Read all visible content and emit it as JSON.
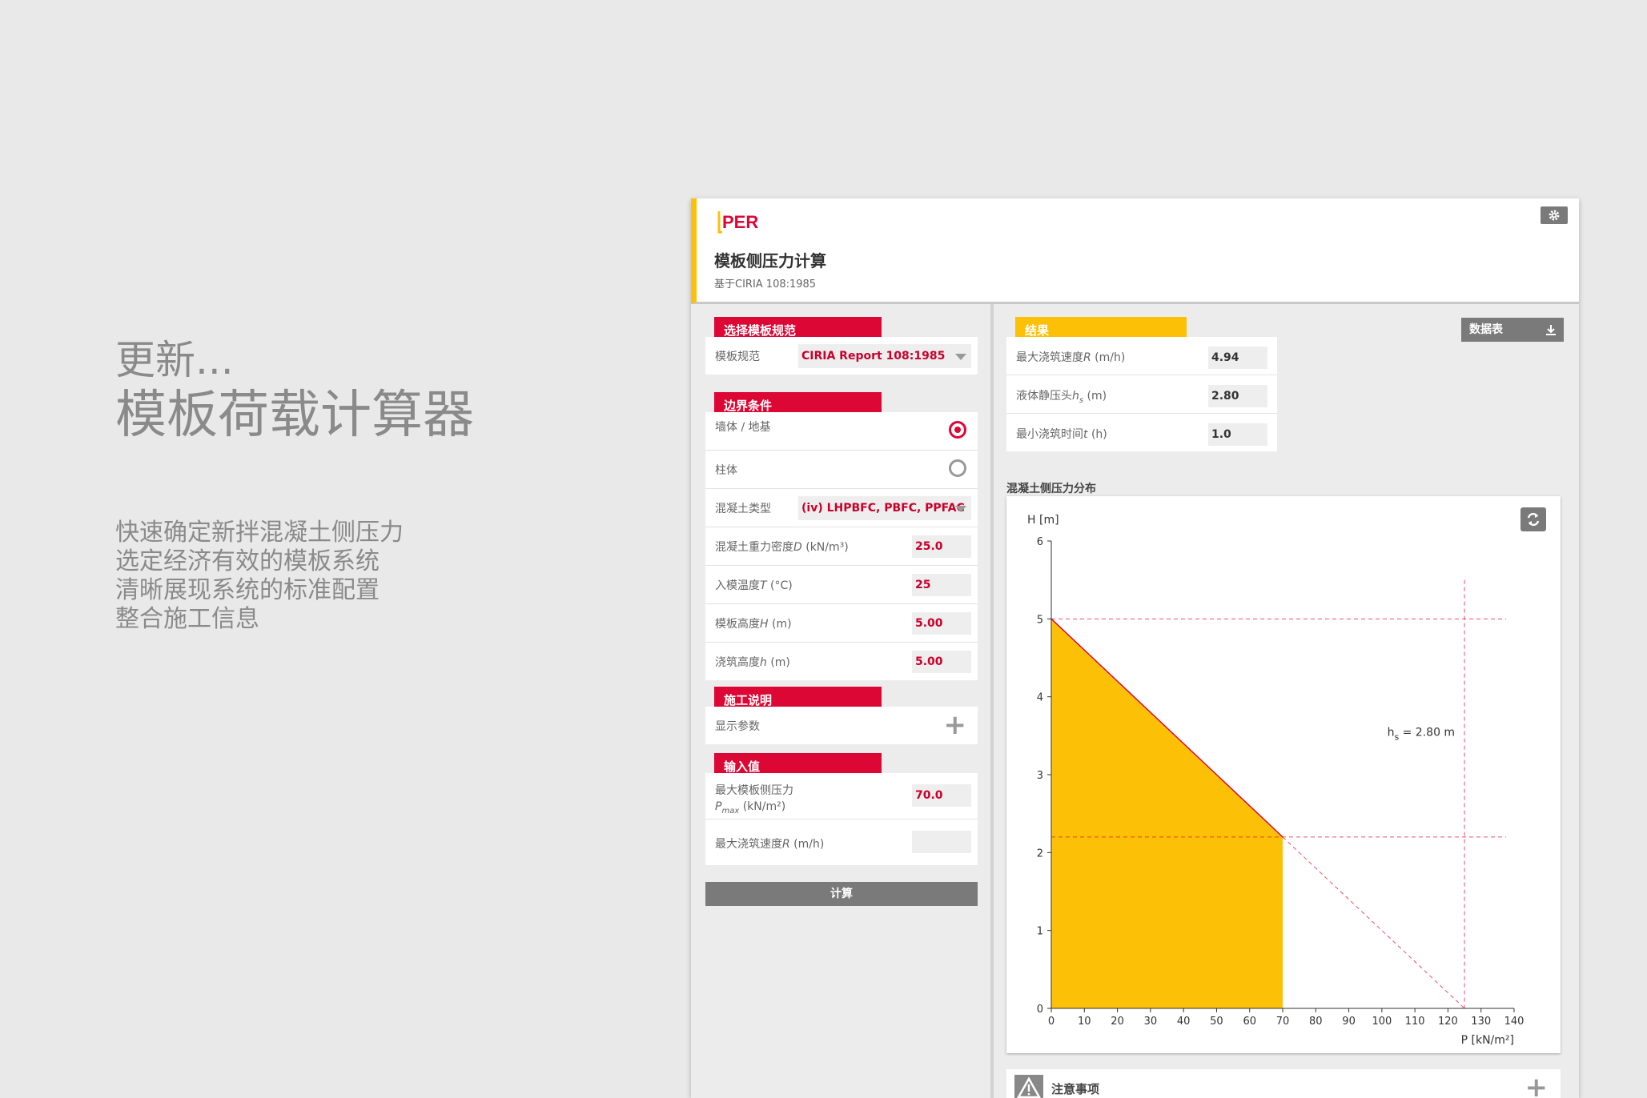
{
  "promo": {
    "line1": "更新...",
    "line2": "模板荷载计算器",
    "bullets": [
      "快速确定新拌混凝土侧压力",
      "选定经济有效的模板系统",
      "清晰展现系统的标准配置",
      "整合施工信息"
    ]
  },
  "app": {
    "logo": "PERI",
    "title": "模板侧压力计算",
    "subtitle": "基于CIRIA 108:1985"
  },
  "spec": {
    "section": "选择模板规范",
    "label": "模板规范",
    "value": "CIRIA Report 108:1985"
  },
  "boundary": {
    "section": "边界条件",
    "wall_label": "墙体 / 地基",
    "column_label": "柱体",
    "concrete_type_label": "混凝土类型",
    "concrete_type_value": "(iv) LHPBFC, PBFC, PPFAC",
    "density_label_pre": "混凝土重力密度",
    "density_sym": "D",
    "density_unit": " (kN/m³)",
    "density_value": "25.0",
    "temp_label_pre": "入模温度",
    "temp_sym": "T",
    "temp_unit": " (°C)",
    "temp_value": "25",
    "form_h_label_pre": "模板高度",
    "form_h_sym": "H",
    "form_h_unit": " (m)",
    "form_h_value": "5.00",
    "pour_h_label_pre": "浇筑高度",
    "pour_h_sym": "h",
    "pour_h_unit": " (m)",
    "pour_h_value": "5.00"
  },
  "construction": {
    "section": "施工说明",
    "show_params": "显示参数"
  },
  "input": {
    "section": "输入值",
    "pmax_label": "最大模板侧压力",
    "pmax_sym": "P",
    "pmax_sub": "max",
    "pmax_unit": " (kN/m²)",
    "pmax_value": "70.0",
    "rate_label_pre": "最大浇筑速度",
    "rate_sym": "R",
    "rate_unit": " (m/h)",
    "rate_value": ""
  },
  "calc_button": "计算",
  "results": {
    "section": "结果",
    "datasheet_button": "数据表",
    "rate_label_pre": "最大浇筑速度",
    "rate_sym": "R",
    "rate_unit": " (m/h)",
    "rate_value": "4.94",
    "hs_label_pre": "液体静压头",
    "hs_sym": "h",
    "hs_sub": "s",
    "hs_unit": " (m)",
    "hs_value": "2.80",
    "time_label_pre": "最小浇筑时间",
    "time_sym": "t",
    "time_unit": " (h)",
    "time_value": "1.0"
  },
  "chart_section": "混凝土侧压力分布",
  "notes": "注意事项",
  "colors": {
    "red": "#dd0735",
    "yellow": "#fcc107",
    "gray": "#7a7a7a"
  },
  "chart_data": {
    "type": "area",
    "ylabel": "H [m]",
    "xlabel": "P [kN/m²]",
    "xlim": [
      0,
      140
    ],
    "ylim": [
      0,
      6
    ],
    "xticks": [
      0,
      10,
      20,
      30,
      40,
      50,
      60,
      70,
      80,
      90,
      100,
      110,
      120,
      130,
      140
    ],
    "yticks": [
      0,
      1,
      2,
      3,
      4,
      5,
      6
    ],
    "pressure_profile": [
      {
        "p": 0,
        "h": 5.0
      },
      {
        "p": 70,
        "h": 2.2
      },
      {
        "p": 70,
        "h": 0
      }
    ],
    "hydrostatic_line": [
      {
        "p": 70,
        "h": 2.2
      },
      {
        "p": 125,
        "h": 0
      }
    ],
    "ref_h_lines": [
      5.0,
      2.2
    ],
    "ref_p_line": 125,
    "annotation": "h_s = 2.80 m",
    "annotation_main": "h",
    "annotation_sub": "s",
    "annotation_rest": " = 2.80 m"
  }
}
